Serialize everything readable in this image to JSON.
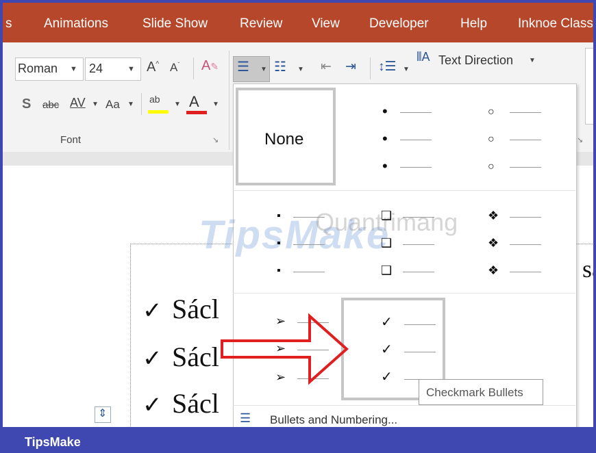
{
  "menu": {
    "tabs": [
      "s",
      "Animations",
      "Slide Show",
      "Review",
      "View",
      "Developer",
      "Help",
      "Inknoe Class"
    ]
  },
  "font_group": {
    "font_name": "Roman",
    "font_size": "24",
    "group_label": "Font",
    "strikethrough": "abc",
    "spacing": "AV",
    "change_case": "Aa",
    "highlight": "ab"
  },
  "paragraph_group": {
    "text_direction": "Text Direction"
  },
  "dropdown": {
    "none_label": "None",
    "tooltip": "Checkmark Bullets",
    "footer_link": "Bullets and Numbering...",
    "symbols": {
      "filled_round": "•",
      "hollow_round": "○",
      "filled_square": "▪",
      "hollow_square": "❑",
      "diamond": "❖",
      "arrow": "➢",
      "check": "✓"
    }
  },
  "slide": {
    "lines": [
      "Sácl",
      "Sácl",
      "Sácl"
    ],
    "right_fragment": "sa",
    "check": "✓"
  },
  "watermark": {
    "main": "TipsMake",
    "secondary": "Quantrimang"
  },
  "footer": {
    "brand": "TipsMake"
  },
  "colors": {
    "menu_bar": "#b7472a",
    "frame": "#3f48b0",
    "arrow": "#e02020",
    "highlight_bar": "#ffff00",
    "font_color_bar": "#e02020"
  }
}
